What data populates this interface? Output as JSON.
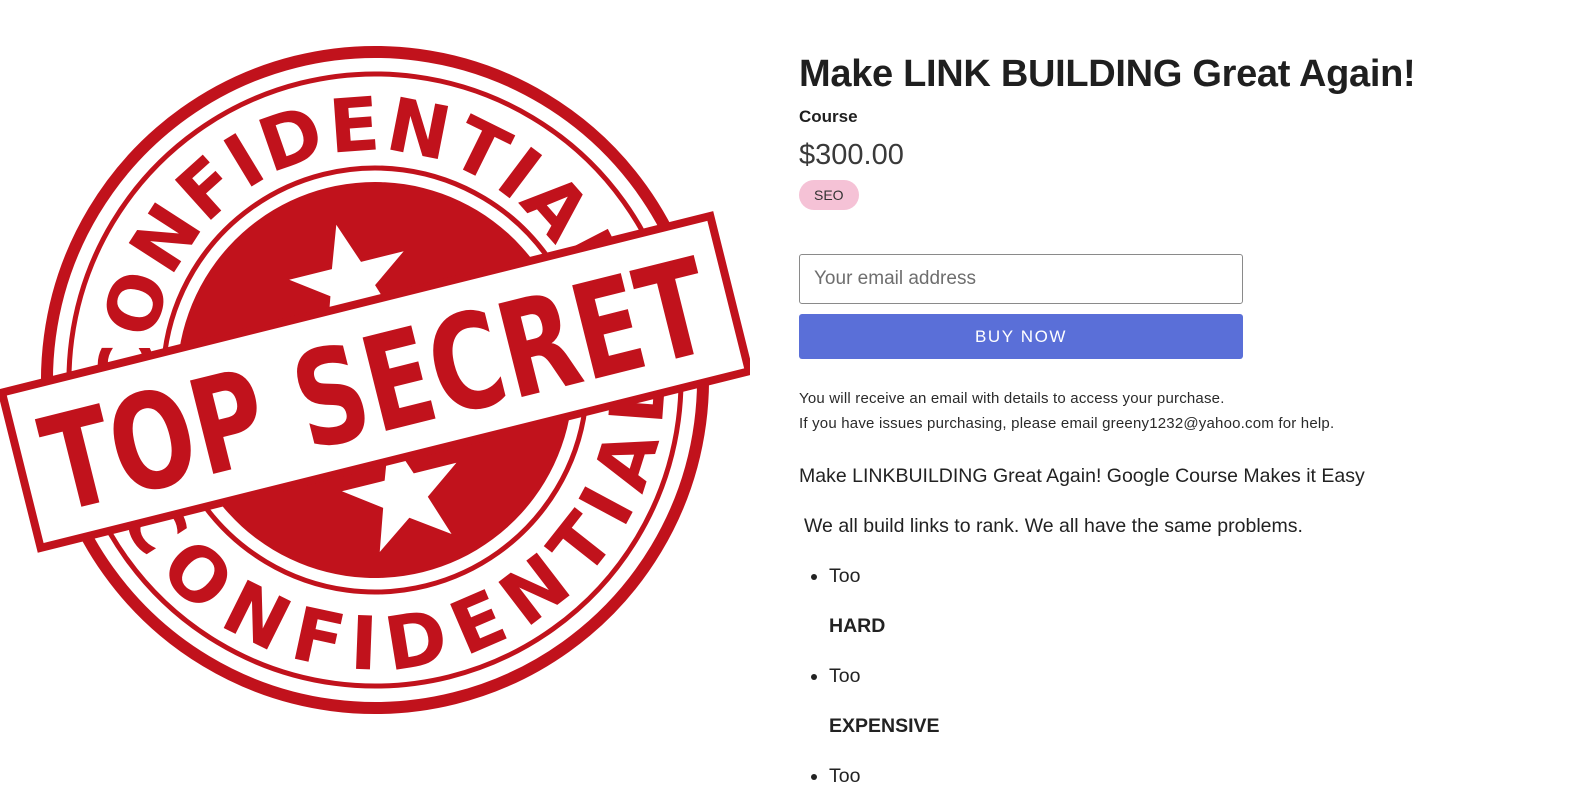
{
  "stamp": {
    "top_arc_text": "CONFIDENTIAL",
    "bottom_arc_text": "CONFIDENTIAL",
    "banner_text": "TOP SECRET",
    "color": "#c1121c"
  },
  "product": {
    "title": "Make LINK BUILDING Great Again!",
    "type": "Course",
    "price": "$300.00",
    "tag": "SEO"
  },
  "checkout": {
    "email_placeholder": "Your email address",
    "buy_label": "BUY NOW",
    "button_color": "#5a6fd8"
  },
  "notice": {
    "line1": "You will receive an email with details to access your purchase.",
    "line2": "If you have issues purchasing, please email greeny1232@yahoo.com for help."
  },
  "description": {
    "intro": "Make LINKBUILDING Great Again! Google Course Makes it Easy",
    "para": "We all build links to rank.  We all have the same problems.",
    "items": [
      {
        "text": "Too",
        "emphasis": "HARD"
      },
      {
        "text": "Too",
        "emphasis": "EXPENSIVE"
      },
      {
        "text": "Too"
      }
    ]
  }
}
